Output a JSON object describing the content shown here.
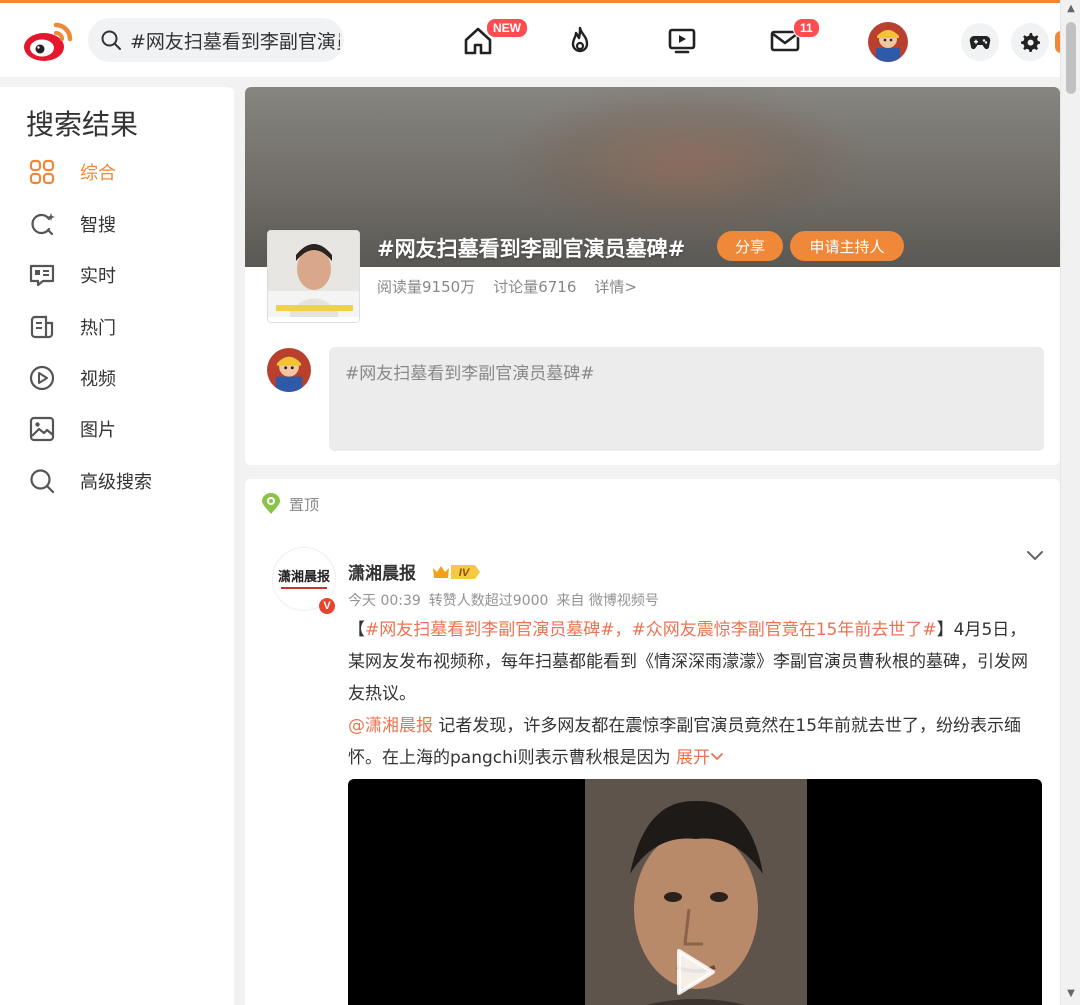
{
  "header": {
    "search": {
      "value": "#网友扫墓看到李副官演员墓碑#"
    },
    "nav": {
      "home_badge": "NEW",
      "mail_badge": "11"
    }
  },
  "sidebar": {
    "title": "搜索结果",
    "items": [
      {
        "label": "综合",
        "icon": "grid-icon",
        "active": true
      },
      {
        "label": "智搜",
        "icon": "smart-search-icon"
      },
      {
        "label": "实时",
        "icon": "realtime-icon"
      },
      {
        "label": "热门",
        "icon": "hot-icon"
      },
      {
        "label": "视频",
        "icon": "video-play-icon"
      },
      {
        "label": "图片",
        "icon": "image-icon"
      },
      {
        "label": "高级搜索",
        "icon": "search-icon"
      }
    ]
  },
  "topic": {
    "title": "#网友扫墓看到李副官演员墓碑#",
    "share_label": "分享",
    "host_label": "申请主持人",
    "reads": "阅读量9150万",
    "discussions": "讨论量6716",
    "details": "详情>",
    "composer_value": "#网友扫墓看到李副官演员墓碑#"
  },
  "post": {
    "pinned_label": "置顶",
    "author": "潇湘晨报",
    "level": "IV",
    "time": "今天 00:39",
    "reposts": "转赞人数超过9000",
    "source": "来自 微博视频号",
    "avatar_text": "潇湘晨报",
    "bracket_open": "【",
    "tag1": "#网友扫墓看到李副官演员墓碑#",
    "comma": "，",
    "tag2": "#众网友震惊李副官竟在15年前去世了#",
    "text1": "】4月5日，某网友发布视频称，每年扫墓都能看到《情深深雨濛濛》李副官演员曹秋根的墓碑，引发网友热议。",
    "mention": "@潇湘晨报",
    "text2": " 记者发现，许多网友都在震惊李副官演员竟然在15年前就去世了，纷纷表示缅怀。在上海的pangchi则表示曹秋根是因为",
    "more": "展开"
  },
  "colors": {
    "accent": "#f0883a",
    "link": "#eb7350",
    "badge": "#ff4d4f"
  }
}
